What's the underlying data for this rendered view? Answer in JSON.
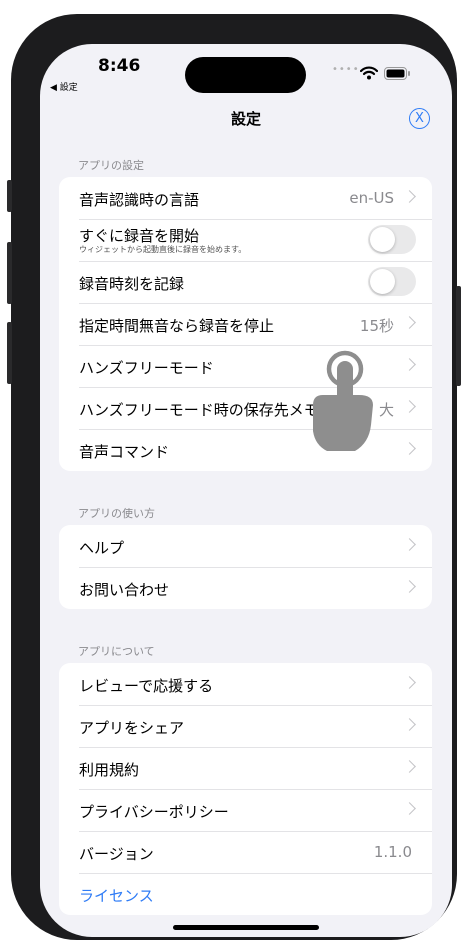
{
  "status": {
    "time": "8:46",
    "back_label": "◀ 設定",
    "signal": "••••"
  },
  "nav": {
    "title": "設定",
    "close_symbol": "X"
  },
  "sections": [
    {
      "header": "アプリの設定"
    },
    {
      "header": "アプリの使い方"
    },
    {
      "header": "アプリについて"
    }
  ],
  "app_settings": {
    "language": {
      "label": "音声認識時の言語",
      "value": "en-US"
    },
    "start_recording": {
      "label": "すぐに録音を開始",
      "sublabel": "ウィジェットから起動直後に録音を始めます。",
      "on": false
    },
    "record_time": {
      "label": "録音時刻を記録",
      "on": false
    },
    "silence_stop": {
      "label": "指定時間無音なら録音を停止",
      "value": "15秒"
    },
    "handsfree": {
      "label": "ハンズフリーモード"
    },
    "handsfree_save": {
      "label": "ハンズフリーモード時の保存先メモ",
      "value": "大"
    },
    "voice_commands": {
      "label": "音声コマンド"
    }
  },
  "usage": {
    "help": {
      "label": "ヘルプ"
    },
    "contact": {
      "label": "お問い合わせ"
    }
  },
  "about": {
    "review": {
      "label": "レビューで応援する"
    },
    "share": {
      "label": "アプリをシェア"
    },
    "terms": {
      "label": "利用規約"
    },
    "privacy": {
      "label": "プライバシーポリシー"
    },
    "version": {
      "label": "バージョン",
      "value": "1.1.0"
    },
    "license": {
      "label": "ライセンス"
    }
  },
  "colors": {
    "accent": "#2f7cf6",
    "background": "#f2f2f7",
    "secondary_text": "#8a8a8e"
  },
  "overlay": {
    "icon": "tap-hand-icon"
  }
}
